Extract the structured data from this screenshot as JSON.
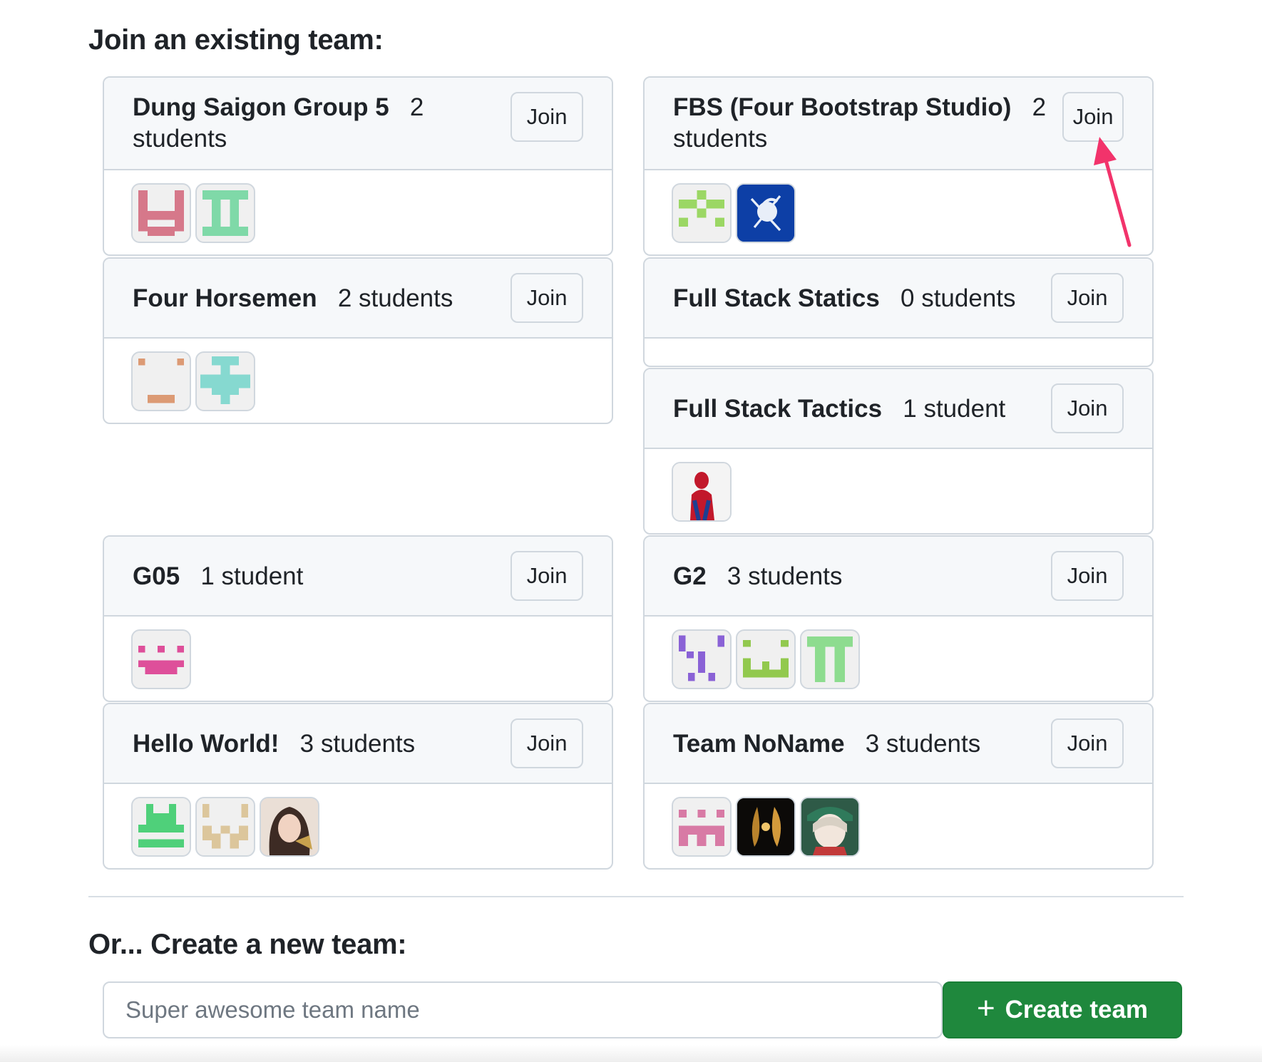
{
  "join_heading": "Join an existing team:",
  "create_heading": "Or... Create a new team:",
  "teams": [
    {
      "name": "Dung Saigon Group 5",
      "count": "2",
      "count_label": "students",
      "join_label": "Join",
      "avatars": [
        "identicon-red",
        "identicon-mint"
      ]
    },
    {
      "name": "FBS (Four Bootstrap Studio)",
      "count": "2",
      "count_label": "students",
      "join_label": "Join",
      "avatars": [
        "identicon-lime",
        "spartan-photo"
      ]
    },
    {
      "name": "Four Horsemen",
      "count": "2 students",
      "join_label": "Join",
      "avatars": [
        "identicon-orange",
        "identicon-teal"
      ]
    },
    {
      "name": "Full Stack Statics",
      "count": "0 students",
      "join_label": "Join",
      "avatars": []
    },
    {
      "name": "Full Stack Tactics",
      "count": "1 student",
      "join_label": "Join",
      "avatars": [
        "spiderman-photo"
      ]
    },
    {
      "name": "G05",
      "count": "1 student",
      "join_label": "Join",
      "avatars": [
        "identicon-pink"
      ]
    },
    {
      "name": "G2",
      "count": "3 students",
      "join_label": "Join",
      "avatars": [
        "identicon-purple",
        "identicon-yellowgreen",
        "identicon-green"
      ]
    },
    {
      "name": "Hello World!",
      "count": "3 students",
      "join_label": "Join",
      "avatars": [
        "identicon-green-bright",
        "identicon-beige",
        "person-photo"
      ]
    },
    {
      "name": "Team NoName",
      "count": "3 students",
      "join_label": "Join",
      "avatars": [
        "identicon-rose",
        "dark-gold-photo",
        "anime-photo"
      ]
    }
  ],
  "new_team": {
    "placeholder": "Super awesome team name",
    "button_icon": "plus-icon",
    "button_label": "Create team"
  },
  "annotation": {
    "type": "arrow",
    "color": "#f2336b",
    "target": "fbs-join-button"
  },
  "colors": {
    "card_border": "#d0d7de",
    "card_header_bg": "#f6f8fa",
    "primary_button": "#1f883d",
    "text": "#1f2328"
  }
}
